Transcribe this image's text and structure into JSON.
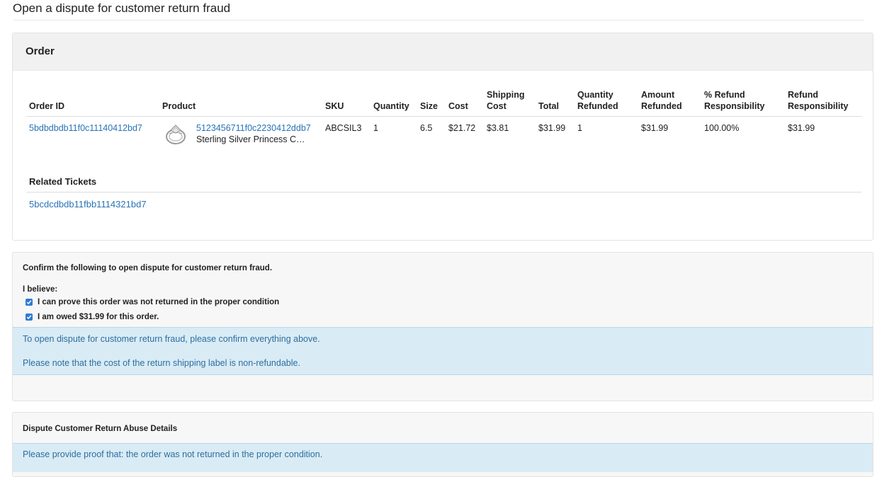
{
  "page": {
    "title": "Open a dispute for customer return fraud"
  },
  "order": {
    "heading": "Order",
    "columns": [
      "Order ID",
      "Product",
      "SKU",
      "Quantity",
      "Size",
      "Cost",
      "Shipping Cost",
      "Total",
      "Quantity Refunded",
      "Amount Refunded",
      "% Refund Responsibility",
      "Refund Responsibility"
    ],
    "row": {
      "order_id": "5bdbdbdb11f0c11140412bd7",
      "product_id": "5123456711f0c2230412ddb7",
      "product_name": "Sterling Silver Princess C…",
      "sku": "ABCSIL3",
      "quantity": "1",
      "size": "6.5",
      "cost": "$21.72",
      "shipping_cost": "$3.81",
      "total": "$31.99",
      "quantity_refunded": "1",
      "amount_refunded": "$31.99",
      "pct_refund_responsibility": "100.00%",
      "refund_responsibility": "$31.99"
    },
    "related_tickets": {
      "heading": "Related Tickets",
      "items": [
        "5bcdcdbdb11fbb1114321bd7"
      ]
    }
  },
  "confirm": {
    "title": "Confirm the following to open dispute for customer return fraud.",
    "believe_label": "I believe:",
    "checks": [
      {
        "label": "I can prove this order was not returned in the proper condition",
        "checked": true
      },
      {
        "label": "I am owed $31.99 for this order.",
        "checked": true
      }
    ],
    "info_lines": [
      "To open dispute for customer return fraud, please confirm everything above.",
      "Please note that the cost of the return shipping label is non-refundable."
    ]
  },
  "details": {
    "title": "Dispute Customer Return Abuse Details",
    "info": "Please provide proof that: the order was not returned in the proper condition."
  },
  "colors": {
    "link": "#2a73b5",
    "info_bg": "#d9ebf5",
    "info_text": "#2e6e9e",
    "checkbox": "#2f7ad3"
  },
  "icons": {
    "product_thumbnail": "ring-icon",
    "checkbox": "checkmark-icon"
  }
}
